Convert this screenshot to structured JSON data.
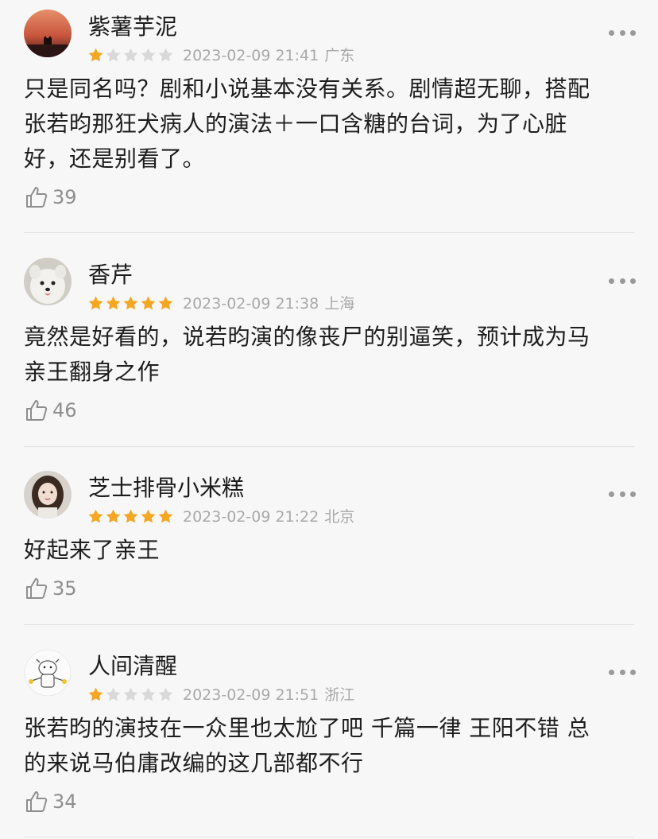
{
  "reviews": [
    {
      "user": "紫薯芋泥",
      "avatar_icon": "sunset-cat-avatar",
      "rating": 1,
      "date": "2023-02-09 21:41",
      "location": "广东",
      "lines": [
        "只是同名吗？剧和小说基本没有关系。剧情超无聊，搭配",
        "张若昀那狂犬病人的演法＋一口含糖的台词，为了心脏",
        "好，还是别看了。"
      ],
      "likes": "39"
    },
    {
      "user": "香芹",
      "avatar_icon": "white-dog-avatar",
      "rating": 5,
      "date": "2023-02-09 21:38",
      "location": "上海",
      "lines": [
        "竟然是好看的，说若昀演的像丧尸的别逼笑，预计成为马",
        "亲王翻身之作"
      ],
      "likes": "46"
    },
    {
      "user": "芝士排骨小米糕",
      "avatar_icon": "girl-portrait-avatar",
      "rating": 5,
      "date": "2023-02-09 21:22",
      "location": "北京",
      "lines": [
        "好起来了亲王"
      ],
      "likes": "35"
    },
    {
      "user": "人间清醒",
      "avatar_icon": "cartoon-cow-avatar",
      "rating": 1,
      "date": "2023-02-09 21:51",
      "location": "浙江",
      "lines": [
        "张若昀的演技在一众里也太尬了吧 千篇一律 王阳不错 总",
        "的来说马伯庸改编的这几部都不行"
      ],
      "likes": "34"
    }
  ],
  "colors": {
    "star_on": "#f5a623",
    "star_off": "#d9d9d9",
    "meta": "#a9a9a9"
  },
  "icons": {
    "like": "thumbs-up-icon",
    "more": "more-dots-icon"
  }
}
